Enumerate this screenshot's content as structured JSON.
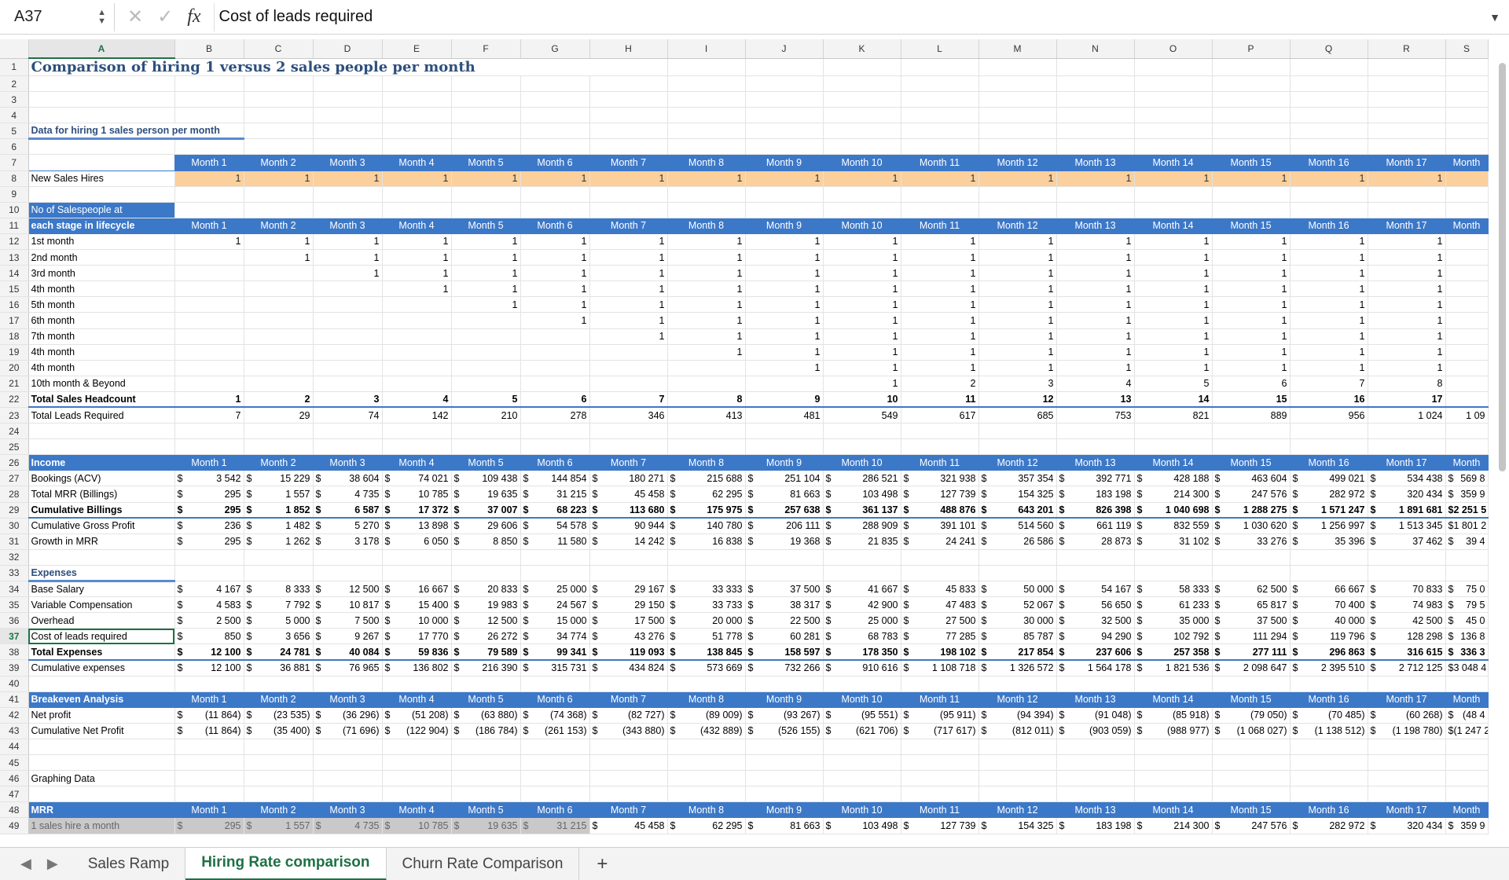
{
  "formula_bar": {
    "cell_ref": "A37",
    "formula": "Cost of leads required"
  },
  "columns": [
    "A",
    "B",
    "C",
    "D",
    "E",
    "F",
    "G",
    "H",
    "I",
    "J",
    "K",
    "L",
    "M",
    "N",
    "O",
    "P",
    "Q",
    "R",
    "S"
  ],
  "title": "Comparison of hiring 1 versus 2 sales people per month",
  "section_1": "Data for hiring 1 sales person per month",
  "months": [
    "Month 1",
    "Month 2",
    "Month 3",
    "Month 4",
    "Month 5",
    "Month 6",
    "Month 7",
    "Month 8",
    "Month 9",
    "Month 10",
    "Month 11",
    "Month 12",
    "Month 13",
    "Month 14",
    "Month 15",
    "Month 16",
    "Month 17",
    "Month"
  ],
  "new_sales_hires": {
    "label": "New Sales Hires",
    "values": [
      "1",
      "1",
      "1",
      "1",
      "1",
      "1",
      "1",
      "1",
      "1",
      "1",
      "1",
      "1",
      "1",
      "1",
      "1",
      "1",
      "1",
      ""
    ]
  },
  "stage_label_1": "No of Salespeople at",
  "stage_label_2": "each stage in lifecycle",
  "stages": [
    {
      "label": "1st month",
      "values": [
        "1",
        "1",
        "1",
        "1",
        "1",
        "1",
        "1",
        "1",
        "1",
        "1",
        "1",
        "1",
        "1",
        "1",
        "1",
        "1",
        "1",
        ""
      ]
    },
    {
      "label": "2nd month",
      "values": [
        "",
        "1",
        "1",
        "1",
        "1",
        "1",
        "1",
        "1",
        "1",
        "1",
        "1",
        "1",
        "1",
        "1",
        "1",
        "1",
        "1",
        ""
      ]
    },
    {
      "label": "3rd month",
      "values": [
        "",
        "",
        "1",
        "1",
        "1",
        "1",
        "1",
        "1",
        "1",
        "1",
        "1",
        "1",
        "1",
        "1",
        "1",
        "1",
        "1",
        ""
      ]
    },
    {
      "label": "4th month",
      "values": [
        "",
        "",
        "",
        "1",
        "1",
        "1",
        "1",
        "1",
        "1",
        "1",
        "1",
        "1",
        "1",
        "1",
        "1",
        "1",
        "1",
        ""
      ]
    },
    {
      "label": "5th month",
      "values": [
        "",
        "",
        "",
        "",
        "1",
        "1",
        "1",
        "1",
        "1",
        "1",
        "1",
        "1",
        "1",
        "1",
        "1",
        "1",
        "1",
        ""
      ]
    },
    {
      "label": "6th month",
      "values": [
        "",
        "",
        "",
        "",
        "",
        "1",
        "1",
        "1",
        "1",
        "1",
        "1",
        "1",
        "1",
        "1",
        "1",
        "1",
        "1",
        ""
      ]
    },
    {
      "label": "7th month",
      "values": [
        "",
        "",
        "",
        "",
        "",
        "",
        "1",
        "1",
        "1",
        "1",
        "1",
        "1",
        "1",
        "1",
        "1",
        "1",
        "1",
        ""
      ]
    },
    {
      "label": "4th month",
      "values": [
        "",
        "",
        "",
        "",
        "",
        "",
        "",
        "1",
        "1",
        "1",
        "1",
        "1",
        "1",
        "1",
        "1",
        "1",
        "1",
        ""
      ]
    },
    {
      "label": "4th month",
      "values": [
        "",
        "",
        "",
        "",
        "",
        "",
        "",
        "",
        "1",
        "1",
        "1",
        "1",
        "1",
        "1",
        "1",
        "1",
        "1",
        ""
      ]
    },
    {
      "label": "10th month & Beyond",
      "values": [
        "",
        "",
        "",
        "",
        "",
        "",
        "",
        "",
        "",
        "1",
        "2",
        "3",
        "4",
        "5",
        "6",
        "7",
        "8",
        ""
      ]
    }
  ],
  "total_headcount": {
    "label": "Total Sales Headcount",
    "values": [
      "1",
      "2",
      "3",
      "4",
      "5",
      "6",
      "7",
      "8",
      "9",
      "10",
      "11",
      "12",
      "13",
      "14",
      "15",
      "16",
      "17",
      ""
    ]
  },
  "total_leads": {
    "label": "Total Leads Required",
    "values": [
      "7",
      "29",
      "74",
      "142",
      "210",
      "278",
      "346",
      "413",
      "481",
      "549",
      "617",
      "685",
      "753",
      "821",
      "889",
      "956",
      "1 024",
      "1 09"
    ]
  },
  "income_label": "Income",
  "income_rows": [
    {
      "label": "Bookings (ACV)",
      "bold": false,
      "values": [
        "3 542",
        "15 229",
        "38 604",
        "74 021",
        "109 438",
        "144 854",
        "180 271",
        "215 688",
        "251 104",
        "286 521",
        "321 938",
        "357 354",
        "392 771",
        "428 188",
        "463 604",
        "499 021",
        "534 438",
        "569 8"
      ]
    },
    {
      "label": "Total MRR (Billings)",
      "bold": false,
      "values": [
        "295",
        "1 557",
        "4 735",
        "10 785",
        "19 635",
        "31 215",
        "45 458",
        "62 295",
        "81 663",
        "103 498",
        "127 739",
        "154 325",
        "183 198",
        "214 300",
        "247 576",
        "282 972",
        "320 434",
        "359 9"
      ]
    },
    {
      "label": "Cumulative Billings",
      "bold": true,
      "values": [
        "295",
        "1 852",
        "6 587",
        "17 372",
        "37 007",
        "68 223",
        "113 680",
        "175 975",
        "257 638",
        "361 137",
        "488 876",
        "643 201",
        "826 398",
        "1 040 698",
        "1 288 275",
        "1 571 247",
        "1 891 681",
        "2 251 5"
      ]
    },
    {
      "label": "Cumulative Gross Profit",
      "bold": false,
      "values": [
        "236",
        "1 482",
        "5 270",
        "13 898",
        "29 606",
        "54 578",
        "90 944",
        "140 780",
        "206 111",
        "288 909",
        "391 101",
        "514 560",
        "661 119",
        "832 559",
        "1 030 620",
        "1 256 997",
        "1 513 345",
        "1 801 2"
      ]
    },
    {
      "label": "Growth in MRR",
      "bold": false,
      "values": [
        "295",
        "1 262",
        "3 178",
        "6 050",
        "8 850",
        "11 580",
        "14 242",
        "16 838",
        "19 368",
        "21 835",
        "24 241",
        "26 586",
        "28 873",
        "31 102",
        "33 276",
        "35 396",
        "37 462",
        "39 4"
      ]
    }
  ],
  "expenses_label": "Expenses",
  "expense_rows": [
    {
      "label": "Base Salary",
      "bold": false,
      "values": [
        "4 167",
        "8 333",
        "12 500",
        "16 667",
        "20 833",
        "25 000",
        "29 167",
        "33 333",
        "37 500",
        "41 667",
        "45 833",
        "50 000",
        "54 167",
        "58 333",
        "62 500",
        "66 667",
        "70 833",
        "75 0"
      ]
    },
    {
      "label": "Variable Compensation",
      "bold": false,
      "values": [
        "4 583",
        "7 792",
        "10 817",
        "15 400",
        "19 983",
        "24 567",
        "29 150",
        "33 733",
        "38 317",
        "42 900",
        "47 483",
        "52 067",
        "56 650",
        "61 233",
        "65 817",
        "70 400",
        "74 983",
        "79 5"
      ]
    },
    {
      "label": "Overhead",
      "bold": false,
      "values": [
        "2 500",
        "5 000",
        "7 500",
        "10 000",
        "12 500",
        "15 000",
        "17 500",
        "20 000",
        "22 500",
        "25 000",
        "27 500",
        "30 000",
        "32 500",
        "35 000",
        "37 500",
        "40 000",
        "42 500",
        "45 0"
      ]
    },
    {
      "label": "Cost of leads required",
      "bold": false,
      "values": [
        "850",
        "3 656",
        "9 267",
        "17 770",
        "26 272",
        "34 774",
        "43 276",
        "51 778",
        "60 281",
        "68 783",
        "77 285",
        "85 787",
        "94 290",
        "102 792",
        "111 294",
        "119 796",
        "128 298",
        "136 8"
      ]
    },
    {
      "label": "Total Expenses",
      "bold": true,
      "values": [
        "12 100",
        "24 781",
        "40 084",
        "59 836",
        "79 589",
        "99 341",
        "119 093",
        "138 845",
        "158 597",
        "178 350",
        "198 102",
        "217 854",
        "237 606",
        "257 358",
        "277 111",
        "296 863",
        "316 615",
        "336 3"
      ]
    },
    {
      "label": "Cumulative expenses",
      "bold": false,
      "values": [
        "12 100",
        "36 881",
        "76 965",
        "136 802",
        "216 390",
        "315 731",
        "434 824",
        "573 669",
        "732 266",
        "910 616",
        "1 108 718",
        "1 326 572",
        "1 564 178",
        "1 821 536",
        "2 098 647",
        "2 395 510",
        "2 712 125",
        "3 048 4"
      ]
    }
  ],
  "breakeven_label": "Breakeven Analysis",
  "breakeven_rows": [
    {
      "label": "Net profit",
      "bold": false,
      "values": [
        "(11 864)",
        "(23 535)",
        "(36 296)",
        "(51 208)",
        "(63 880)",
        "(74 368)",
        "(82 727)",
        "(89 009)",
        "(93 267)",
        "(95 551)",
        "(95 911)",
        "(94 394)",
        "(91 048)",
        "(85 918)",
        "(79 050)",
        "(70 485)",
        "(60 268)",
        "(48 4"
      ]
    },
    {
      "label": "Cumulative Net Profit",
      "bold": false,
      "values": [
        "(11 864)",
        "(35 400)",
        "(71 696)",
        "(122 904)",
        "(186 784)",
        "(261 153)",
        "(343 880)",
        "(432 889)",
        "(526 155)",
        "(621 706)",
        "(717 617)",
        "(812 011)",
        "(903 059)",
        "(988 977)",
        "(1 068 027)",
        "(1 138 512)",
        "(1 198 780)",
        "(1 247 2"
      ]
    }
  ],
  "graphing_label": "Graphing Data",
  "mrr_label": "MRR",
  "mrr_row": {
    "label": "1 sales hire a month",
    "values": [
      "295",
      "1 557",
      "4 735",
      "10 785",
      "19 635",
      "31 215",
      "45 458",
      "62 295",
      "81 663",
      "103 498",
      "127 739",
      "154 325",
      "183 198",
      "214 300",
      "247 576",
      "282 972",
      "320 434",
      "359 9"
    ]
  },
  "currency": "$",
  "sheet_tabs": [
    "Sales Ramp",
    "Hiring Rate comparison",
    "Churn Rate Comparison"
  ],
  "active_tab": "Hiring Rate comparison",
  "add_tab": "+",
  "colors": {
    "header_blue": "#3c78c8",
    "title_blue": "#2d4f7c",
    "orange_fill": "#fbd09c",
    "selection_green": "#1e7145"
  }
}
